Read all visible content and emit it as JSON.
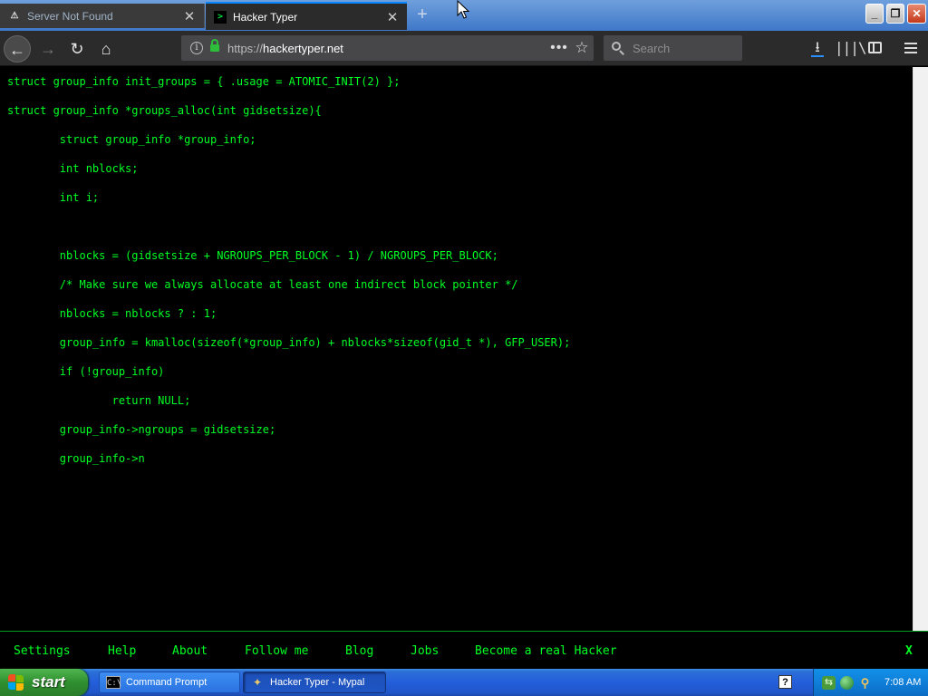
{
  "browser": {
    "tabs": [
      {
        "title": "Server Not Found",
        "icon": "warning-icon",
        "active": false
      },
      {
        "title": "Hacker Typer",
        "icon": "terminal-favicon",
        "active": true
      }
    ],
    "new_tab_symbol": "+",
    "window_controls": {
      "minimize": "_",
      "maximize": "❐",
      "close": "✕"
    },
    "url": {
      "protocol": "https://",
      "host": "hackertyper.net"
    },
    "search_placeholder": "Search"
  },
  "page": {
    "text_color": "#00ff24",
    "background_color": "#000000",
    "code_lines": [
      "struct group_info init_groups = { .usage = ATOMIC_INIT(2) };",
      "struct group_info *groups_alloc(int gidsetsize){",
      "        struct group_info *group_info;",
      "        int nblocks;",
      "        int i;",
      "",
      "        nblocks = (gidsetsize + NGROUPS_PER_BLOCK - 1) / NGROUPS_PER_BLOCK;",
      "        /* Make sure we always allocate at least one indirect block pointer */",
      "        nblocks = nblocks ? : 1;",
      "        group_info = kmalloc(sizeof(*group_info) + nblocks*sizeof(gid_t *), GFP_USER);",
      "        if (!group_info)",
      "                return NULL;",
      "        group_info->ngroups = gidsetsize;",
      "        group_info->n"
    ]
  },
  "footer": {
    "links": [
      "Settings",
      "Help",
      "About",
      "Follow me",
      "Blog",
      "Jobs",
      "Become a real Hacker"
    ],
    "close_label": "X"
  },
  "taskbar": {
    "start_label": "start",
    "tasks": [
      {
        "label": "Command Prompt",
        "icon": "cmd-icon"
      },
      {
        "label": "Hacker Typer - Mypal",
        "icon": "browser-app-icon"
      }
    ],
    "clock": "7:08 AM"
  }
}
